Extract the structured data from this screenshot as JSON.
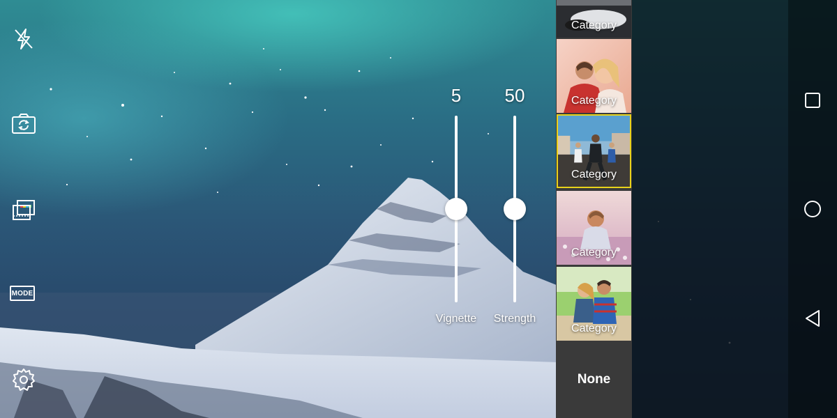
{
  "camera": {
    "left_toolbar": {
      "flash_icon": "flash-off-icon",
      "switch_camera_icon": "camera-switch-icon",
      "effects_icon": "filter-effects-icon",
      "mode_label": "MODE",
      "settings_icon": "gear-icon"
    },
    "sliders": [
      {
        "label": "Vignette",
        "value": "5",
        "level_percent": 50
      },
      {
        "label": "Strength",
        "value": "50",
        "level_percent": 50
      }
    ]
  },
  "filter_panel": {
    "items": [
      {
        "label": "Category",
        "selected": false
      },
      {
        "label": "Category",
        "selected": false
      },
      {
        "label": "Category",
        "selected": true
      },
      {
        "label": "Category",
        "selected": false
      },
      {
        "label": "Category",
        "selected": false
      }
    ],
    "none_label": "None",
    "selected_border_color": "#e8d21a"
  },
  "nav_bar": {
    "recents_icon": "square-recents-icon",
    "home_icon": "circle-home-icon",
    "back_icon": "triangle-back-icon"
  }
}
